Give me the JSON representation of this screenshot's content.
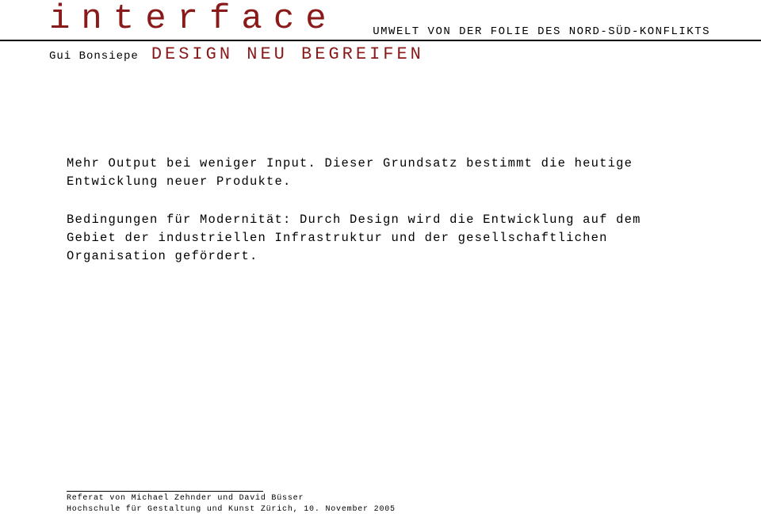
{
  "header": {
    "brand": "interface",
    "author": "Gui Bonsiepe",
    "subtitle": "DESIGN NEU BEGREIFEN",
    "section_title": "UMWELT VON DER FOLIE DES NORD-SÜD-KONFLIKTS"
  },
  "body": {
    "p1": "Mehr Output bei weniger Input. Dieser Grundsatz bestimmt die heutige Entwicklung neuer Produkte.",
    "p2": "Bedingungen für Modernität: Durch Design wird die Entwicklung auf dem Gebiet der industriellen Infrastruktur und der gesellschaftlichen Organisation gefördert."
  },
  "footer": {
    "line1": "Referat von Michael Zehnder und David Büsser",
    "line2": "Hochschule für Gestaltung und Kunst Zürich, 10. November 2005"
  }
}
